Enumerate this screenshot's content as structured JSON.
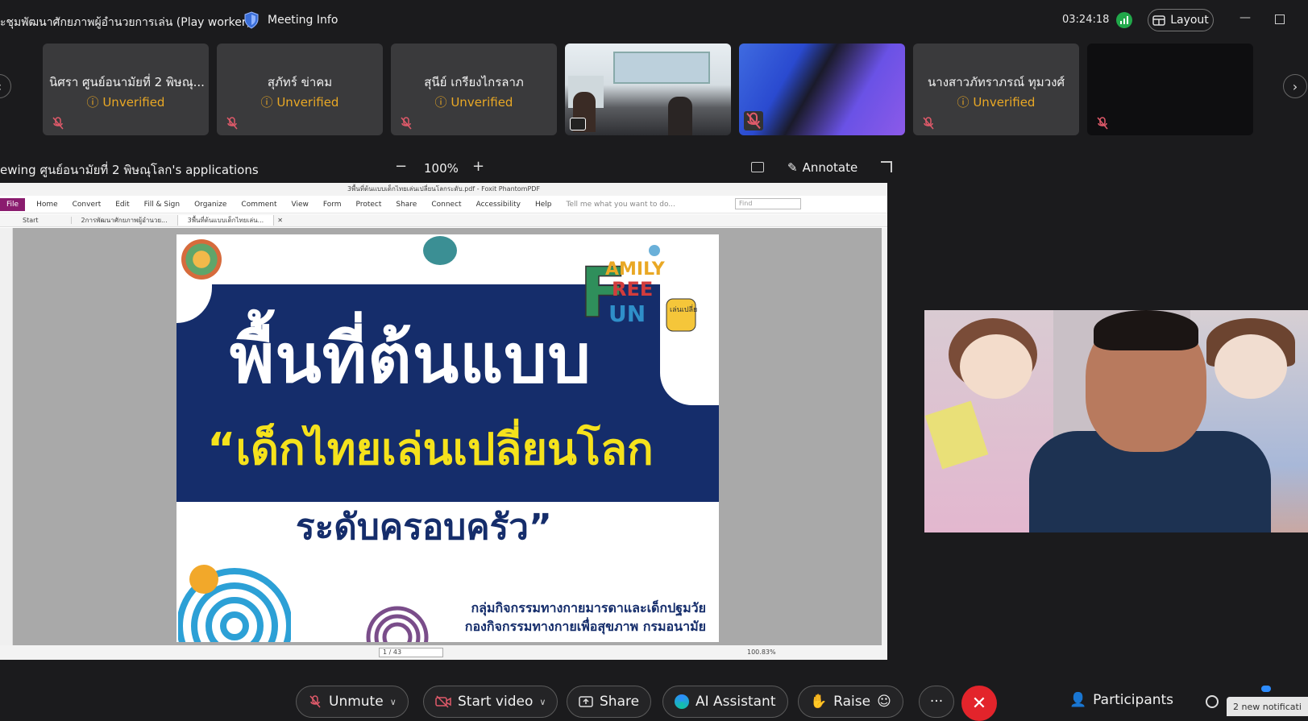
{
  "header": {
    "meeting_title": "ะชุมพัฒนาศักยภาพผู้อำนวยการเล่น (Play worker)",
    "meeting_info_label": "Meeting Info",
    "clock": "03:24:18",
    "layout_label": "Layout"
  },
  "participants_strip": [
    {
      "name": "นิศรา ศูนย์อนามัยที่ 2 พิษณุ...",
      "status": "Unverified",
      "kind": "avatar"
    },
    {
      "name": "สุภัทร์ ข่าคม",
      "status": "Unverified",
      "kind": "avatar"
    },
    {
      "name": "สุนีย์ เกรียงไกรลาภ",
      "status": "Unverified",
      "kind": "avatar"
    },
    {
      "name": "",
      "status": "",
      "kind": "video-room"
    },
    {
      "name": "",
      "status": "",
      "kind": "video-abstract"
    },
    {
      "name": "นางสาวภัทราภรณ์ ทุมวงศ์",
      "status": "Unverified",
      "kind": "avatar"
    },
    {
      "name": "",
      "status": "",
      "kind": "black"
    }
  ],
  "share_bar": {
    "viewing_label": "ewing ศูนย์อนามัยที่ 2 พิษณุโลก's applications",
    "zoom_value": "100%",
    "annotate_label": "Annotate"
  },
  "foxit": {
    "title": "3พื้นที่ต้นแบบเด็กไทยเล่นเปลี่ยนโลกระดับ.pdf - Foxit PhantomPDF",
    "menu": [
      "File",
      "Home",
      "Convert",
      "Edit",
      "Fill & Sign",
      "Organize",
      "Comment",
      "View",
      "Form",
      "Protect",
      "Share",
      "Connect",
      "Accessibility",
      "Help"
    ],
    "tell_me": "Tell me what you want to do...",
    "find_placeholder": "Find",
    "tabs": [
      "Start",
      "2การพัฒนาศักยภาพผู้อำนวย...",
      "3พื้นที่ต้นแบบเด็กไทยเล่น..."
    ],
    "page_indicator": "1 / 43",
    "zoom_pct": "100.83%"
  },
  "slide": {
    "headline": "พื้นที่ต้นแบบ",
    "subheadline": "“เด็กไทยเล่นเปลี่ยนโลก",
    "subheadline2": "ระดับครอบครัว”",
    "org_line1": "กลุ่มกิจกรรมทางกายมารดาและเด็กปฐมวัย",
    "org_line2": "กองกิจกรรมทางกายเพื่อสุขภาพ กรมอนามัย",
    "logo_text": "FAMILY FREE FUN",
    "logo_sub": "เล่นเปลี่ยนโลก"
  },
  "toolbar": {
    "unmute_label": "Unmute",
    "start_video_label": "Start video",
    "share_label": "Share",
    "ai_label": "AI Assistant",
    "raise_label": "Raise",
    "more_label": "···",
    "participants_label": "Participants",
    "notification": "2 new notificati"
  },
  "colors": {
    "accent_unverified": "#e9a825",
    "end_call": "#e3242b",
    "slide_navy": "#152d6b",
    "slide_yellow": "#f5e21c",
    "signal_green": "#21a84a"
  }
}
